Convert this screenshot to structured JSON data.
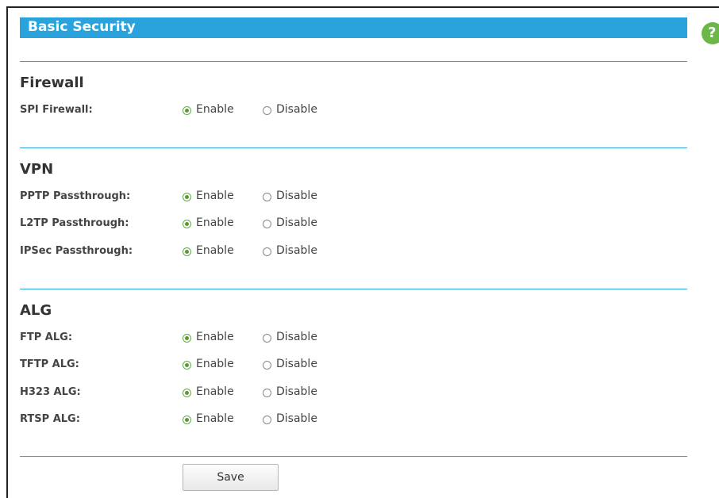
{
  "page": {
    "title": "Basic Security",
    "help_icon_glyph": "?"
  },
  "sections": {
    "firewall": {
      "title": "Firewall",
      "rows": [
        {
          "label": "SPI Firewall:",
          "selected": "enable"
        }
      ]
    },
    "vpn": {
      "title": "VPN",
      "rows": [
        {
          "label": "PPTP Passthrough:",
          "selected": "enable"
        },
        {
          "label": "L2TP Passthrough:",
          "selected": "enable"
        },
        {
          "label": "IPSec Passthrough:",
          "selected": "enable"
        }
      ]
    },
    "alg": {
      "title": "ALG",
      "rows": [
        {
          "label": "FTP ALG:",
          "selected": "enable"
        },
        {
          "label": "TFTP ALG:",
          "selected": "enable"
        },
        {
          "label": "H323 ALG:",
          "selected": "enable"
        },
        {
          "label": "RTSP ALG:",
          "selected": "enable"
        }
      ]
    }
  },
  "options": {
    "enable_label": "Enable",
    "disable_label": "Disable"
  },
  "actions": {
    "save_label": "Save"
  },
  "colors": {
    "accent": "#2aa2dc",
    "help_icon": "#6bb846",
    "radio_checked": "#5a9a2b"
  }
}
